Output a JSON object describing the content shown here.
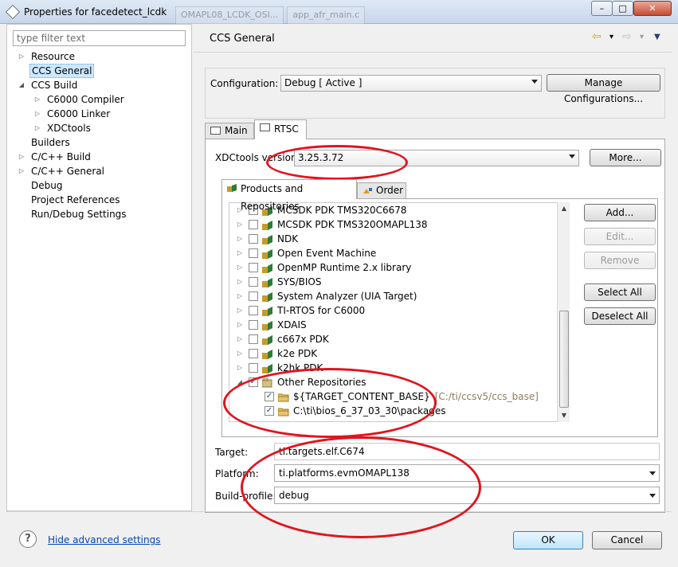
{
  "window": {
    "title": "Properties for facedetect_lcdk",
    "background_tabs": [
      "OMAPL08_LCDK_OSI...",
      "app_afr_main.c"
    ],
    "minimize": "–",
    "maximize": "□",
    "close": "✕"
  },
  "filter": {
    "placeholder": "type filter text"
  },
  "tree": [
    {
      "label": "Resource",
      "arrow": "▷",
      "depth": 0,
      "selected": false
    },
    {
      "label": "CCS General",
      "arrow": "",
      "depth": 0,
      "selected": true
    },
    {
      "label": "CCS Build",
      "arrow": "◢",
      "depth": 0,
      "selected": false
    },
    {
      "label": "C6000 Compiler",
      "arrow": "▷",
      "depth": 1,
      "selected": false
    },
    {
      "label": "C6000 Linker",
      "arrow": "▷",
      "depth": 1,
      "selected": false
    },
    {
      "label": "XDCtools",
      "arrow": "▷",
      "depth": 1,
      "selected": false
    },
    {
      "label": "Builders",
      "arrow": "",
      "depth": 0,
      "selected": false
    },
    {
      "label": "C/C++ Build",
      "arrow": "▷",
      "depth": 0,
      "selected": false
    },
    {
      "label": "C/C++ General",
      "arrow": "▷",
      "depth": 0,
      "selected": false
    },
    {
      "label": "Debug",
      "arrow": "",
      "depth": 0,
      "selected": false
    },
    {
      "label": "Project References",
      "arrow": "",
      "depth": 0,
      "selected": false
    },
    {
      "label": "Run/Debug Settings",
      "arrow": "",
      "depth": 0,
      "selected": false
    }
  ],
  "page": {
    "title": "CCS General",
    "nav": {
      "back": "⇦",
      "back_menu": "▾",
      "forward": "⇨",
      "forward_menu": "▾",
      "view_menu": "▼"
    }
  },
  "configuration": {
    "label": "Configuration:",
    "value": "Debug  [ Active ]",
    "manage_button": "Manage Configurations..."
  },
  "tabs": {
    "main": "Main",
    "rtsc": "RTSC"
  },
  "rtsc": {
    "xdctools_label": "XDCtools version:",
    "xdctools_value": "3.25.3.72",
    "more_button": "More...",
    "subtabs": {
      "products": "Products and Repositories",
      "order": "Order"
    },
    "repositories": [
      {
        "label": "MCSDK PDK TMS320C6678",
        "path": "",
        "arrow": "▷",
        "depth": 0,
        "checked": false,
        "icon": "package"
      },
      {
        "label": "MCSDK PDK TMS320OMAPL138",
        "path": "",
        "arrow": "▷",
        "depth": 0,
        "checked": false,
        "icon": "package"
      },
      {
        "label": "NDK",
        "path": "",
        "arrow": "▷",
        "depth": 0,
        "checked": false,
        "icon": "package"
      },
      {
        "label": "Open Event Machine",
        "path": "",
        "arrow": "▷",
        "depth": 0,
        "checked": false,
        "icon": "package"
      },
      {
        "label": "OpenMP Runtime 2.x library",
        "path": "",
        "arrow": "▷",
        "depth": 0,
        "checked": false,
        "icon": "package"
      },
      {
        "label": "SYS/BIOS",
        "path": "",
        "arrow": "▷",
        "depth": 0,
        "checked": false,
        "icon": "package"
      },
      {
        "label": "System Analyzer (UIA Target)",
        "path": "",
        "arrow": "▷",
        "depth": 0,
        "checked": false,
        "icon": "package"
      },
      {
        "label": "TI-RTOS for C6000",
        "path": "",
        "arrow": "▷",
        "depth": 0,
        "checked": false,
        "icon": "package"
      },
      {
        "label": "XDAIS",
        "path": "",
        "arrow": "▷",
        "depth": 0,
        "checked": false,
        "icon": "package"
      },
      {
        "label": "c667x PDK",
        "path": "",
        "arrow": "▷",
        "depth": 0,
        "checked": false,
        "icon": "package"
      },
      {
        "label": "k2e PDK",
        "path": "",
        "arrow": "▷",
        "depth": 0,
        "checked": false,
        "icon": "package"
      },
      {
        "label": "k2hk PDK",
        "path": "",
        "arrow": "▷",
        "depth": 0,
        "checked": false,
        "icon": "package"
      },
      {
        "label": "Other Repositories",
        "path": "",
        "arrow": "◢",
        "depth": 0,
        "checked": true,
        "icon": "repo"
      },
      {
        "label": "${TARGET_CONTENT_BASE}",
        "path": "[C:/ti/ccsv5/ccs_base]",
        "arrow": "",
        "depth": 1,
        "checked": true,
        "icon": "folder"
      },
      {
        "label": "C:\\ti\\bios_6_37_03_30\\packages",
        "path": "",
        "arrow": "",
        "depth": 1,
        "checked": true,
        "icon": "folder"
      }
    ],
    "buttons": {
      "add": "Add...",
      "edit": "Edit...",
      "remove": "Remove",
      "select_all": "Select All",
      "deselect_all": "Deselect All"
    },
    "target_label": "Target:",
    "target_value": "ti.targets.elf.C674",
    "platform_label": "Platform:",
    "platform_value": "ti.platforms.evmOMAPL138",
    "build_profile_label": "Build-profile:",
    "build_profile_value": "debug"
  },
  "footer": {
    "help": "?",
    "hide_advanced": "Hide advanced settings",
    "ok": "OK",
    "cancel": "Cancel"
  },
  "colors": {
    "annotation_red": "#e0141e",
    "selection": "#cce8ff",
    "link": "#0645ad"
  }
}
